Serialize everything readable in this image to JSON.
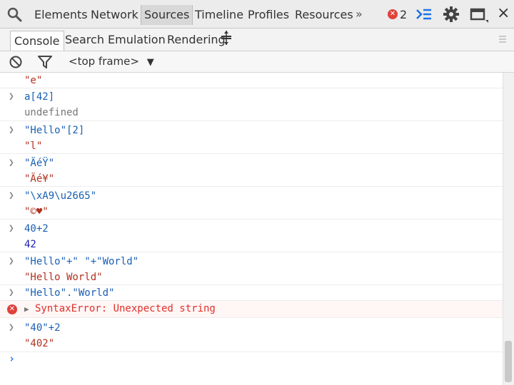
{
  "toolbar": {
    "tabs": [
      "Elements",
      "Network",
      "Sources",
      "Timeline",
      "Profiles",
      "Resources"
    ],
    "active_tab": "Sources",
    "more": "»",
    "error_badge": "✕",
    "error_count": "2"
  },
  "drawer": {
    "tabs": [
      "Console",
      "Search",
      "Emulation",
      "Rendering"
    ],
    "active_tab": "Console"
  },
  "filter": {
    "frame": "<top frame>",
    "frame_arrow": "▼"
  },
  "console": {
    "lines": [
      {
        "kind": "out-str",
        "text": "\"e\""
      },
      {
        "kind": "in",
        "text": "a[42]"
      },
      {
        "kind": "out-undef",
        "text": "undefined"
      },
      {
        "kind": "in",
        "text": "\"Hello\"[2]"
      },
      {
        "kind": "out-str",
        "text": "\"l\""
      },
      {
        "kind": "in",
        "text": "\"ÄéŸ\""
      },
      {
        "kind": "out-str",
        "text": "\"Äé¥\""
      },
      {
        "kind": "in",
        "text": "\"\\xA9\\u2665\""
      },
      {
        "kind": "out-str",
        "text": "\"©♥\""
      },
      {
        "kind": "in",
        "text": "40+2"
      },
      {
        "kind": "out-num",
        "text": "42"
      },
      {
        "kind": "in",
        "text": "\"Hello\"+\" \"+\"World\""
      },
      {
        "kind": "out-str",
        "text": "\"Hello World\""
      },
      {
        "kind": "in",
        "text": "\"Hello\".\"World\""
      },
      {
        "kind": "error",
        "text": "SyntaxError: Unexpected string"
      },
      {
        "kind": "in",
        "text": "\"40\"+2"
      },
      {
        "kind": "out-str",
        "text": "\"402\""
      }
    ],
    "prompt": "›"
  },
  "colors": {
    "input": "#1a5fb4",
    "string": "#b1311f",
    "number": "#1c22b5",
    "error": "#e0302a",
    "prompt": "#1a73e8"
  }
}
